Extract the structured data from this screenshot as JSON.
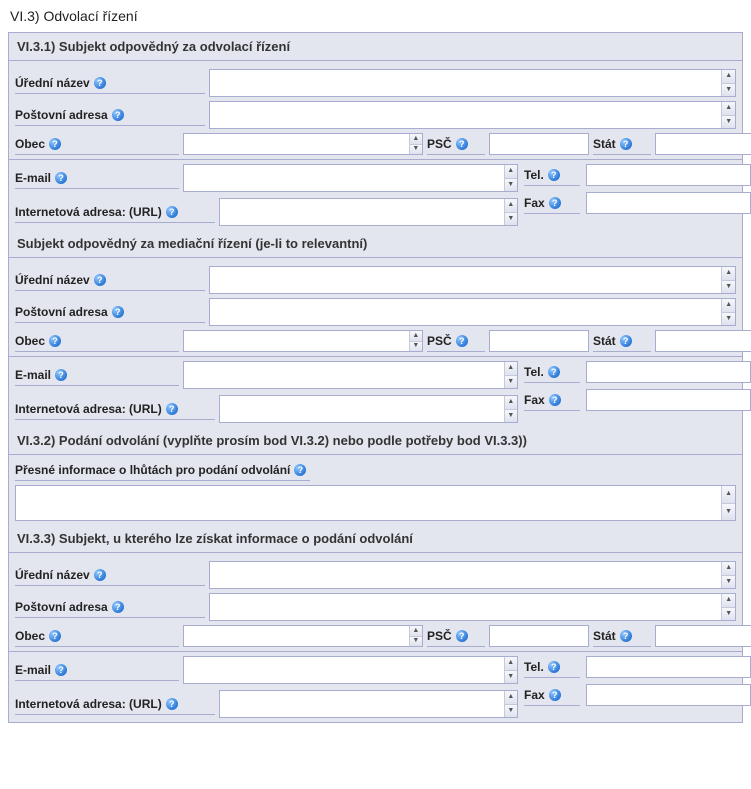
{
  "page_title": "VI.3) Odvolací řízení",
  "s1": {
    "title": "VI.3.1) Subjekt odpovědný za odvolací řízení",
    "official_name_label": "Úřední název",
    "postal_address_label": "Poštovní adresa",
    "city_label": "Obec",
    "psc_label": "PSČ",
    "state_label": "Stát",
    "email_label": "E-mail",
    "tel_label": "Tel.",
    "url_label": "Internetová adresa: (URL)",
    "fax_label": "Fax"
  },
  "s2": {
    "title": "Subjekt odpovědný za mediační řízení (je-li to relevantní)",
    "official_name_label": "Úřední název",
    "postal_address_label": "Poštovní adresa",
    "city_label": "Obec",
    "psc_label": "PSČ",
    "state_label": "Stát",
    "email_label": "E-mail",
    "tel_label": "Tel.",
    "url_label": "Internetová adresa: (URL)",
    "fax_label": "Fax"
  },
  "s3": {
    "title": "VI.3.2) Podání odvolání (vyplňte prosím bod VI.3.2) nebo podle potřeby bod VI.3.3))",
    "deadline_label": "Přesné informace o lhůtách pro podání odvolání"
  },
  "s4": {
    "title": "VI.3.3) Subjekt, u kterého lze získat informace o podání odvolání",
    "official_name_label": "Úřední název",
    "postal_address_label": "Poštovní adresa",
    "city_label": "Obec",
    "psc_label": "PSČ",
    "state_label": "Stát",
    "email_label": "E-mail",
    "tel_label": "Tel.",
    "url_label": "Internetová adresa: (URL)",
    "fax_label": "Fax"
  }
}
